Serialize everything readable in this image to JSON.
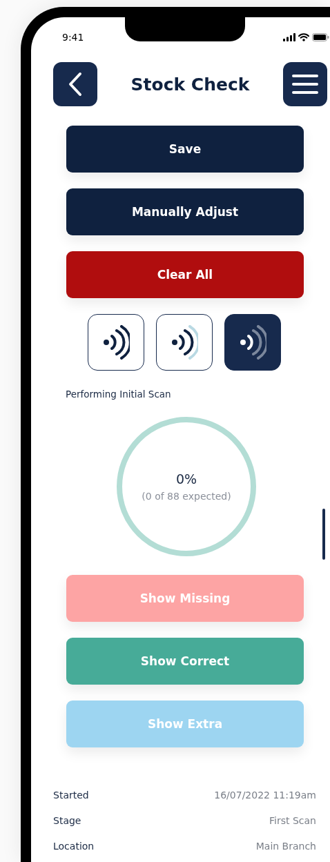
{
  "status_bar": {
    "time": "9:41"
  },
  "header": {
    "title": "Stock Check"
  },
  "actions": [
    {
      "label": "Save",
      "color": "#0f213f"
    },
    {
      "label": "Manually Adjust",
      "color": "#0f213f"
    },
    {
      "label": "Clear All",
      "color": "#b00d0e"
    }
  ],
  "scan_modes": [
    {
      "kind": "strong",
      "selected": false
    },
    {
      "kind": "medium",
      "selected": false
    },
    {
      "kind": "weak",
      "selected": true
    }
  ],
  "scan_status": "Performing Initial Scan",
  "progress": {
    "percent": "0%",
    "detail": "(0 of 88 expected)",
    "level": 0
  },
  "filters": [
    {
      "label": "Show Missing",
      "color": "#fda4a4"
    },
    {
      "label": "Show Correct",
      "color": "#47ab98"
    },
    {
      "label": "Show Extra",
      "color": "#9dd5f1"
    }
  ],
  "details": [
    {
      "label": "Started",
      "value": "16/07/2022 11:19am"
    },
    {
      "label": "Stage",
      "value": "First Scan"
    },
    {
      "label": "Location",
      "value": "Main Branch"
    }
  ]
}
